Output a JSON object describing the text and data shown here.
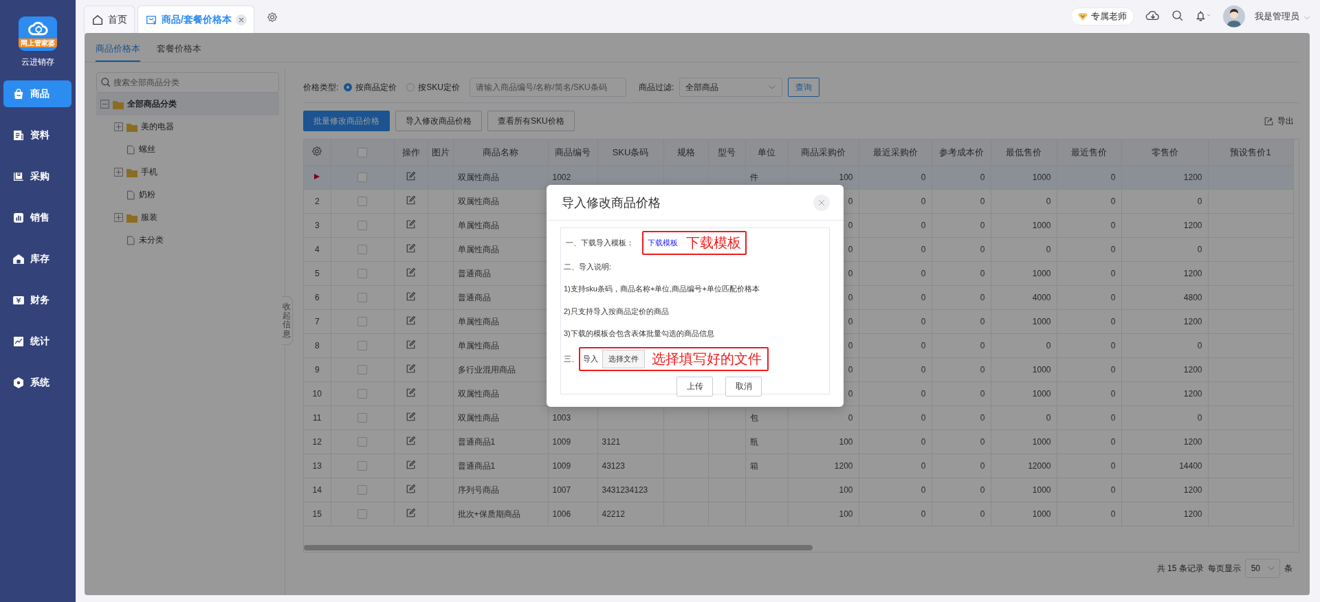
{
  "sidebar": {
    "logo_badge": "网上管家婆",
    "app_name": "云进销存",
    "items": [
      {
        "label": "商品",
        "selected": true
      },
      {
        "label": "资料",
        "selected": false
      },
      {
        "label": "采购",
        "selected": false
      },
      {
        "label": "销售",
        "selected": false
      },
      {
        "label": "库存",
        "selected": false
      },
      {
        "label": "财务",
        "selected": false
      },
      {
        "label": "统计",
        "selected": false
      },
      {
        "label": "系统",
        "selected": false
      }
    ]
  },
  "tabs": [
    {
      "label": "首页",
      "selected": false,
      "closable": false
    },
    {
      "label": "商品/套餐价格本",
      "selected": true,
      "closable": true
    }
  ],
  "header": {
    "teacher": "专属老师",
    "user": "我是管理员"
  },
  "subtabs": [
    {
      "label": "商品价格本",
      "selected": true
    },
    {
      "label": "套餐价格本",
      "selected": false
    }
  ],
  "tree": {
    "search": {
      "placeholder": "搜索全部商品分类"
    },
    "items": [
      {
        "label": "全部商品分类",
        "kind": "folder",
        "expanded": true,
        "selected": true,
        "children": [
          {
            "label": "美的电器",
            "kind": "folder",
            "expanded": false,
            "selected": false
          },
          {
            "label": "螺丝",
            "kind": "file",
            "selected": false
          },
          {
            "label": "手机",
            "kind": "folder",
            "expanded": false,
            "selected": false
          },
          {
            "label": "奶粉",
            "kind": "file",
            "selected": false
          },
          {
            "label": "服装",
            "kind": "folder",
            "expanded": false,
            "selected": false
          },
          {
            "label": "未分类",
            "kind": "file",
            "selected": false
          }
        ]
      }
    ]
  },
  "collapse_tab": "收起信息",
  "filter": {
    "price_type_label": "价格类型:",
    "price_types": [
      {
        "label": "按商品定价",
        "selected": true
      },
      {
        "label": "按SKU定价",
        "selected": false
      }
    ],
    "search": {
      "placeholder": "请输入商品编号/名称/简名/SKU条码"
    },
    "product_filter_label": "商品过滤:",
    "product_filter": {
      "value": "全部商品"
    },
    "query_button": "查询"
  },
  "actions": [
    {
      "label": "批量修改商品价格",
      "primary": true
    },
    {
      "label": "导入修改商品价格",
      "primary": false
    },
    {
      "label": "查看所有SKU价格",
      "primary": false
    }
  ],
  "export": "导出",
  "table": {
    "header_checkbox": {
      "checked": false
    },
    "columns": [
      "操作",
      "图片",
      "商品名称",
      "商品编号",
      "SKU条码",
      "规格",
      "型号",
      "单位",
      "商品采购价",
      "最近采购价",
      "参考成本价",
      "最低售价",
      "最近售价",
      "零售价",
      "预设售价1"
    ],
    "rows": [
      {
        "selected": true,
        "checked": false,
        "name": "双属性商品",
        "code": "1002",
        "unit": "件",
        "purchase_price": "100",
        "recent_purchase_price": "0",
        "cost_price": "0",
        "min_price": "1000",
        "recent_price": "0",
        "retail_price": "1200"
      },
      {
        "no": "2",
        "selected": false,
        "checked": false,
        "name": "双属性商品",
        "purchase_price": "0",
        "recent_purchase_price": "0",
        "cost_price": "0",
        "min_price": "0",
        "recent_price": "0",
        "retail_price": "0"
      },
      {
        "no": "3",
        "selected": false,
        "checked": false,
        "name": "单属性商品",
        "purchase_price": "0",
        "recent_purchase_price": "0",
        "cost_price": "0",
        "min_price": "1000",
        "recent_price": "0",
        "retail_price": "1200"
      },
      {
        "no": "4",
        "selected": false,
        "checked": false,
        "name": "单属性商品",
        "purchase_price": "0",
        "recent_purchase_price": "0",
        "cost_price": "0",
        "min_price": "0",
        "recent_price": "0",
        "retail_price": "0"
      },
      {
        "no": "5",
        "selected": false,
        "checked": false,
        "name": "普通商品",
        "purchase_price": "0",
        "recent_purchase_price": "0",
        "cost_price": "0",
        "min_price": "1000",
        "recent_price": "0",
        "retail_price": "1200"
      },
      {
        "no": "6",
        "selected": false,
        "checked": false,
        "name": "普通商品",
        "purchase_price": "0",
        "recent_purchase_price": "0",
        "cost_price": "0",
        "min_price": "4000",
        "recent_price": "0",
        "retail_price": "4800"
      },
      {
        "no": "7",
        "selected": false,
        "checked": false,
        "name": "单属性商品",
        "purchase_price": "0",
        "recent_purchase_price": "0",
        "cost_price": "0",
        "min_price": "1000",
        "recent_price": "0",
        "retail_price": "1200"
      },
      {
        "no": "8",
        "selected": false,
        "checked": false,
        "name": "单属性商品",
        "purchase_price": "0",
        "recent_purchase_price": "0",
        "cost_price": "0",
        "min_price": "0",
        "recent_price": "0",
        "retail_price": "0"
      },
      {
        "no": "9",
        "selected": false,
        "checked": false,
        "name": "多行业混用商品",
        "purchase_price": "0",
        "recent_purchase_price": "0",
        "cost_price": "0",
        "min_price": "1000",
        "recent_price": "0",
        "retail_price": "1200"
      },
      {
        "no": "10",
        "selected": false,
        "checked": false,
        "name": "双属性商品",
        "purchase_price": "0",
        "recent_purchase_price": "0",
        "cost_price": "0",
        "min_price": "1000",
        "recent_price": "0",
        "retail_price": "1200"
      },
      {
        "no": "11",
        "selected": false,
        "checked": false,
        "name": "双属性商品",
        "code": "1003",
        "unit": "包",
        "purchase_price": "0",
        "recent_purchase_price": "0",
        "cost_price": "0",
        "min_price": "0",
        "recent_price": "0",
        "retail_price": "0"
      },
      {
        "no": "12",
        "selected": false,
        "checked": false,
        "name": "普通商品1",
        "code": "1009",
        "sku": "3121",
        "unit": "瓶",
        "purchase_price": "100",
        "recent_purchase_price": "0",
        "cost_price": "0",
        "min_price": "1000",
        "recent_price": "0",
        "retail_price": "1200"
      },
      {
        "no": "13",
        "selected": false,
        "checked": false,
        "name": "普通商品1",
        "code": "1009",
        "sku": "43123",
        "unit": "箱",
        "purchase_price": "1200",
        "recent_purchase_price": "0",
        "cost_price": "0",
        "min_price": "12000",
        "recent_price": "0",
        "retail_price": "14400"
      },
      {
        "no": "14",
        "selected": false,
        "checked": false,
        "name": "序列号商品",
        "code": "1007",
        "sku": "3431234123",
        "purchase_price": "100",
        "recent_purchase_price": "0",
        "cost_price": "0",
        "min_price": "1000",
        "recent_price": "0",
        "retail_price": "1200"
      },
      {
        "no": "15",
        "selected": false,
        "checked": false,
        "name": "批次+保质期商品",
        "code": "1006",
        "sku": "42212",
        "purchase_price": "100",
        "recent_purchase_price": "0",
        "cost_price": "0",
        "min_price": "1000",
        "recent_price": "0",
        "retail_price": "1200"
      }
    ]
  },
  "pager": {
    "total": "共 15 条记录",
    "page_size_label": "每页显示",
    "page_size": "50",
    "unit": "条"
  },
  "dialog": {
    "title": "导入修改商品价格",
    "step1_label": "一、下载导入模板：",
    "template_link": "下载模板",
    "step1_annotation": "下载模板",
    "notes_title": "二、导入说明:",
    "notes": [
      "1)支持sku条码，商品名称+单位,商品编号+单位匹配价格本",
      "2)只支持导入按商品定价的商品",
      "3)下载的模板会包含表体批量勾选的商品信息"
    ],
    "step3_label": "三、",
    "import_label": "导入",
    "file_button": "选择文件",
    "step3_annotation": "选择填写好的文件",
    "buttons": [
      "上传",
      "取消"
    ]
  }
}
